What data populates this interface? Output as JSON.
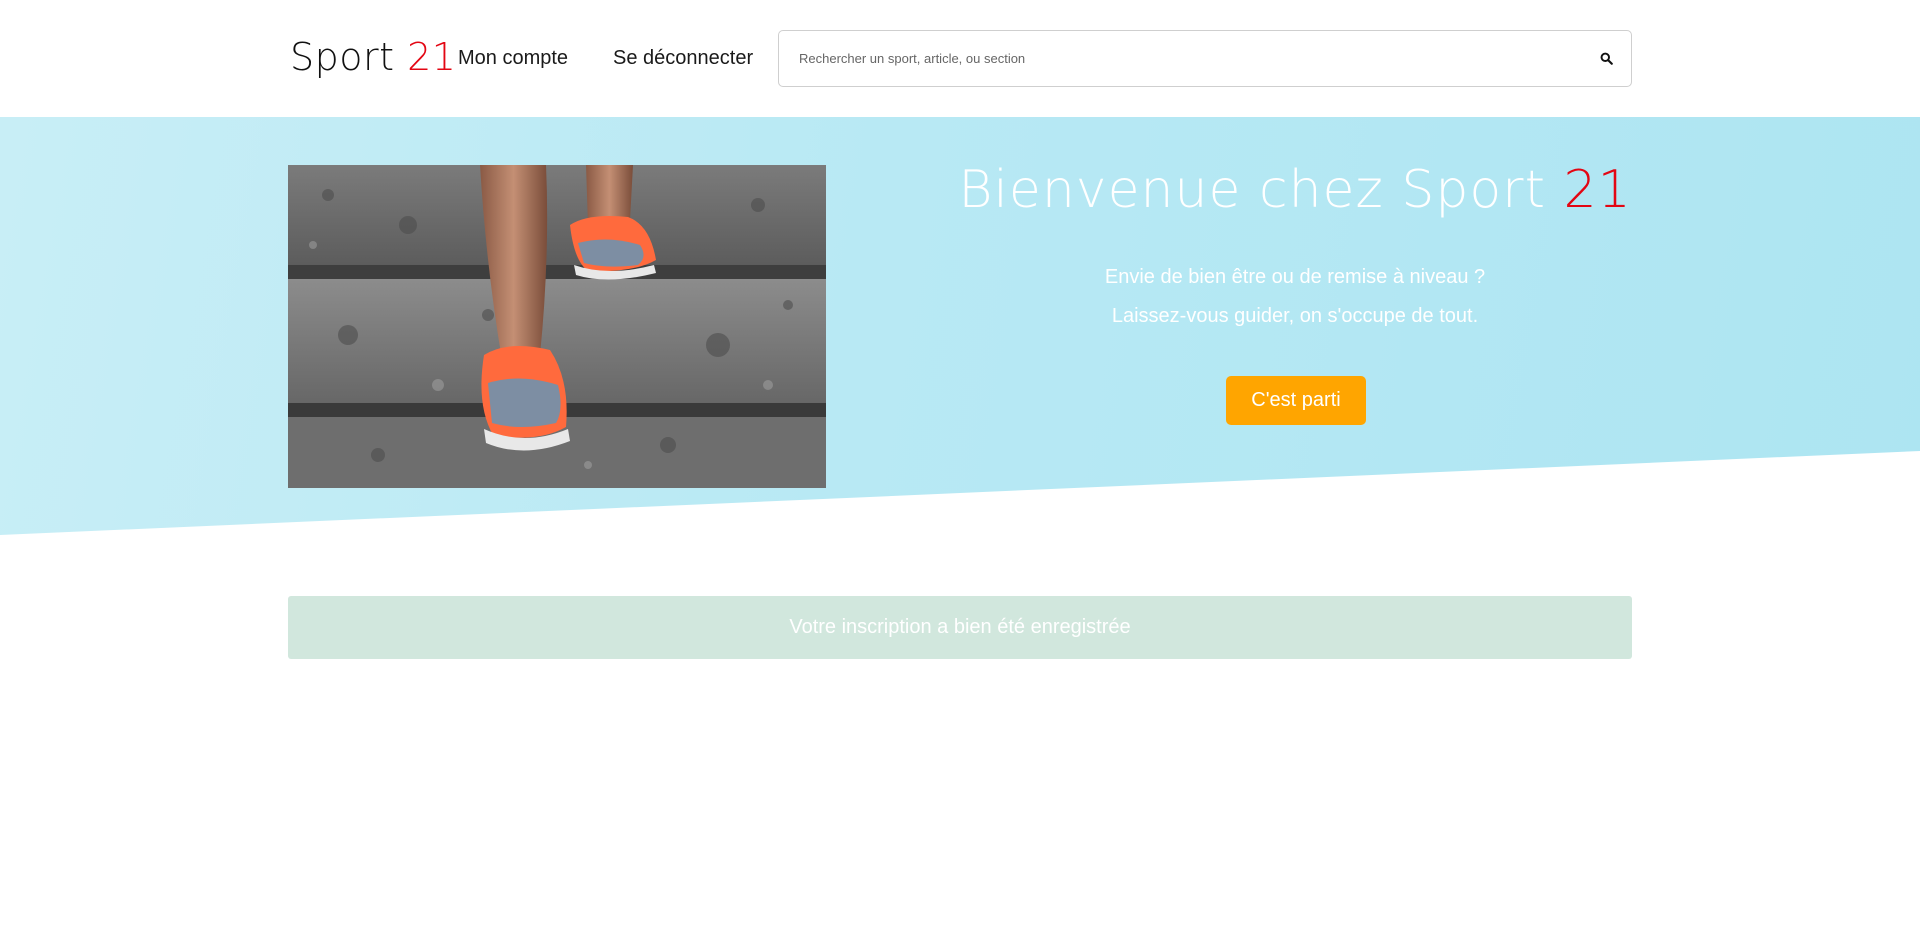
{
  "header": {
    "logo_text": "Sport",
    "logo_number": "21",
    "nav": {
      "account_label": "Mon compte",
      "logout_label": "Se déconnecter"
    },
    "search": {
      "placeholder": "Rechercher un sport, article, ou section",
      "icon": "search-icon"
    }
  },
  "hero": {
    "title_text": "Bienvenue chez Sport",
    "title_number": "21",
    "line1": "Envie de bien être ou de remise à niveau ?",
    "line2": "Laissez-vous guider, on s'occupe de tout.",
    "cta_label": "C'est parti",
    "image": "running-shoes-on-stairs-photo"
  },
  "alert": {
    "message": "Votre inscription a bien été enregistrée"
  },
  "colors": {
    "accent_red": "#e30613",
    "cta_orange": "#ffa500",
    "hero_bg": "#b8e9f4",
    "alert_bg": "#d1e7dd"
  }
}
